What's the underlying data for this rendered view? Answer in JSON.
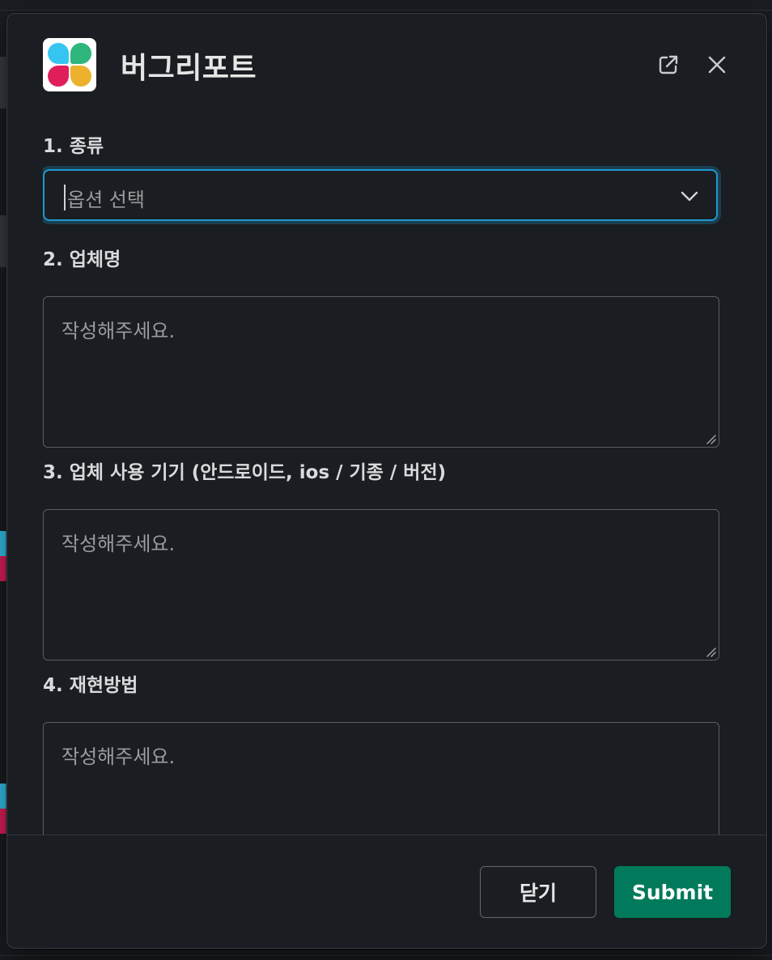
{
  "modal": {
    "title": "버그리포트",
    "app_icon": "slack-logo-icon",
    "header_icons": [
      "external-link-icon",
      "close-icon"
    ]
  },
  "form": {
    "kind": {
      "label": "1. 종류",
      "placeholder": "옵션 선택",
      "icon": "chevron-down-icon"
    },
    "company": {
      "label": "2. 업체명",
      "placeholder": "작성해주세요.",
      "value": ""
    },
    "device": {
      "label": "3. 업체 사용 기기 (안드로이드, ios / 기종 / 버전)",
      "placeholder": "작성해주세요.",
      "value": ""
    },
    "repro": {
      "label": "4. 재현방법",
      "placeholder": "작성해주세요.",
      "value": ""
    }
  },
  "footer": {
    "close_label": "닫기",
    "submit_label": "Submit"
  },
  "colors": {
    "background": "#1a1d21",
    "focus_ring": "#1d9bd1",
    "submit": "#007a5a",
    "logo_blue": "#36c5f0",
    "logo_green": "#2eb67d",
    "logo_red": "#e01e5a",
    "logo_yellow": "#ecb22e"
  }
}
